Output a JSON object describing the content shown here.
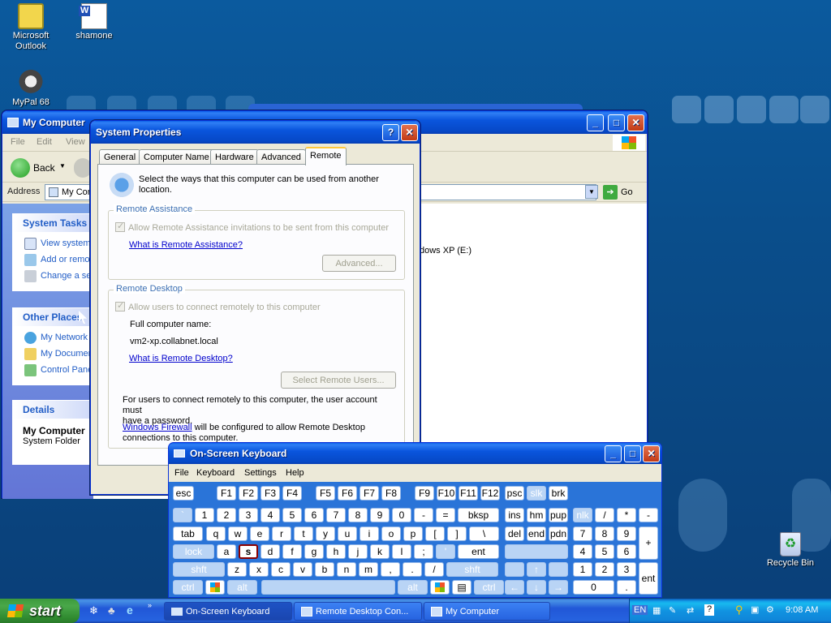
{
  "desktop": {
    "icons": [
      {
        "label_line1": "Microsoft",
        "label_line2": "Outlook"
      },
      {
        "label_line1": "shamone",
        "label_line2": ""
      },
      {
        "label_line1": "MyPal 68",
        "label_line2": ""
      },
      {
        "label_line1": "Recycle Bin",
        "label_line2": ""
      }
    ]
  },
  "my_computer": {
    "title": "My Computer",
    "menu": [
      "File",
      "Edit",
      "View"
    ],
    "back_label": "Back",
    "address_label": "Address",
    "address_value": "My Computer",
    "go_label": "Go",
    "drive_label": "Windows XP (E:)",
    "drive_partial": "dows XP (E:)",
    "system_tasks": {
      "heading": "System Tasks",
      "items": [
        "View system information",
        "Add or remove programs",
        "Change a setting"
      ]
    },
    "other_places": {
      "heading": "Other Places",
      "items": [
        "My Network Places",
        "My Documents",
        "Control Panel"
      ]
    },
    "details": {
      "heading": "Details",
      "name": "My Computer",
      "type": "System Folder"
    }
  },
  "system_properties": {
    "title": "System Properties",
    "help": "?",
    "tabs": [
      "General",
      "Computer Name",
      "Hardware",
      "Advanced",
      "Remote"
    ],
    "active_tab": "Remote",
    "intro": "Select the ways that this computer can be used from another location.",
    "intro_line1": "Select the ways that this computer can be used from another",
    "intro_line2": "location.",
    "remote_assistance": {
      "label": "Remote Assistance",
      "checkbox": "Allow Remote Assistance invitations to be sent from this computer",
      "link": "What is Remote Assistance?",
      "button": "Advanced..."
    },
    "remote_desktop": {
      "label": "Remote Desktop",
      "checkbox": "Allow users to connect remotely to this computer",
      "full_name_label": "Full computer name:",
      "full_name_value": "vm2-xp.collabnet.local",
      "link": "What is Remote Desktop?",
      "button": "Select Remote Users...",
      "note_line1": "For users to connect remotely to this computer, the user account must",
      "note_line2": "have a password.",
      "firewall_link": "Windows Firewall",
      "firewall_rest": " will be configured to allow Remote Desktop",
      "firewall_line2": "connections to this computer."
    }
  },
  "osk": {
    "title": "On-Screen Keyboard",
    "menu": [
      "File",
      "Keyboard",
      "Settings",
      "Help"
    ],
    "keys": {
      "esc": "esc",
      "f1": "F1",
      "f2": "F2",
      "f3": "F3",
      "f4": "F4",
      "f5": "F5",
      "f6": "F6",
      "f7": "F7",
      "f8": "F8",
      "f9": "F9",
      "f10": "F10",
      "f11": "F11",
      "f12": "F12",
      "psc": "psc",
      "slk": "slk",
      "brk": "brk",
      "backtick": "`",
      "n1": "1",
      "n2": "2",
      "n3": "3",
      "n4": "4",
      "n5": "5",
      "n6": "6",
      "n7": "7",
      "n8": "8",
      "n9": "9",
      "n0": "0",
      "minus": "-",
      "equals": "=",
      "bksp": "bksp",
      "ins": "ins",
      "hm": "hm",
      "pup": "pup",
      "nlk": "nlk",
      "np_div": "/",
      "np_mul": "*",
      "np_sub": "-",
      "tab": "tab",
      "q": "q",
      "w": "w",
      "e": "e",
      "r": "r",
      "t": "t",
      "y": "y",
      "u": "u",
      "i": "i",
      "o": "o",
      "p": "p",
      "lbr": "[",
      "rbr": "]",
      "bslash": "\\",
      "del": "del",
      "end": "end",
      "pdn": "pdn",
      "np7": "7",
      "np8": "8",
      "np9": "9",
      "np_add": "+",
      "lock": "lock",
      "a": "a",
      "s": "s",
      "d": "d",
      "f": "f",
      "g": "g",
      "h": "h",
      "j": "j",
      "k": "k",
      "l": "l",
      "semi": ";",
      "quote": "'",
      "ent": "ent",
      "np4": "4",
      "np5": "5",
      "np6": "6",
      "shft": "shft",
      "z": "z",
      "x": "x",
      "c": "c",
      "v": "v",
      "b": "b",
      "n": "n",
      "m": "m",
      "comma": ",",
      "period": ".",
      "slash": "/",
      "rshft": "shft",
      "up": "↑",
      "np1": "1",
      "np2": "2",
      "np3": "3",
      "ctrl": "ctrl",
      "alt": "alt",
      "ralt": "alt",
      "rctrl": "ctrl",
      "left": "←",
      "down": "↓",
      "right": "→",
      "np0": "0",
      "np_dot": ".",
      "np_ent": "ent"
    }
  },
  "taskbar": {
    "start": "start",
    "tasks": [
      "On-Screen Keyboard",
      "Remote Desktop Con...",
      "My Computer"
    ],
    "lang": "EN",
    "clock": "9:08 AM"
  },
  "colors": {
    "xp_blue": "#0a55dd",
    "desktop": "#0a4d8a",
    "start_green": "#3c9a3c",
    "tray": "#1193e1"
  }
}
